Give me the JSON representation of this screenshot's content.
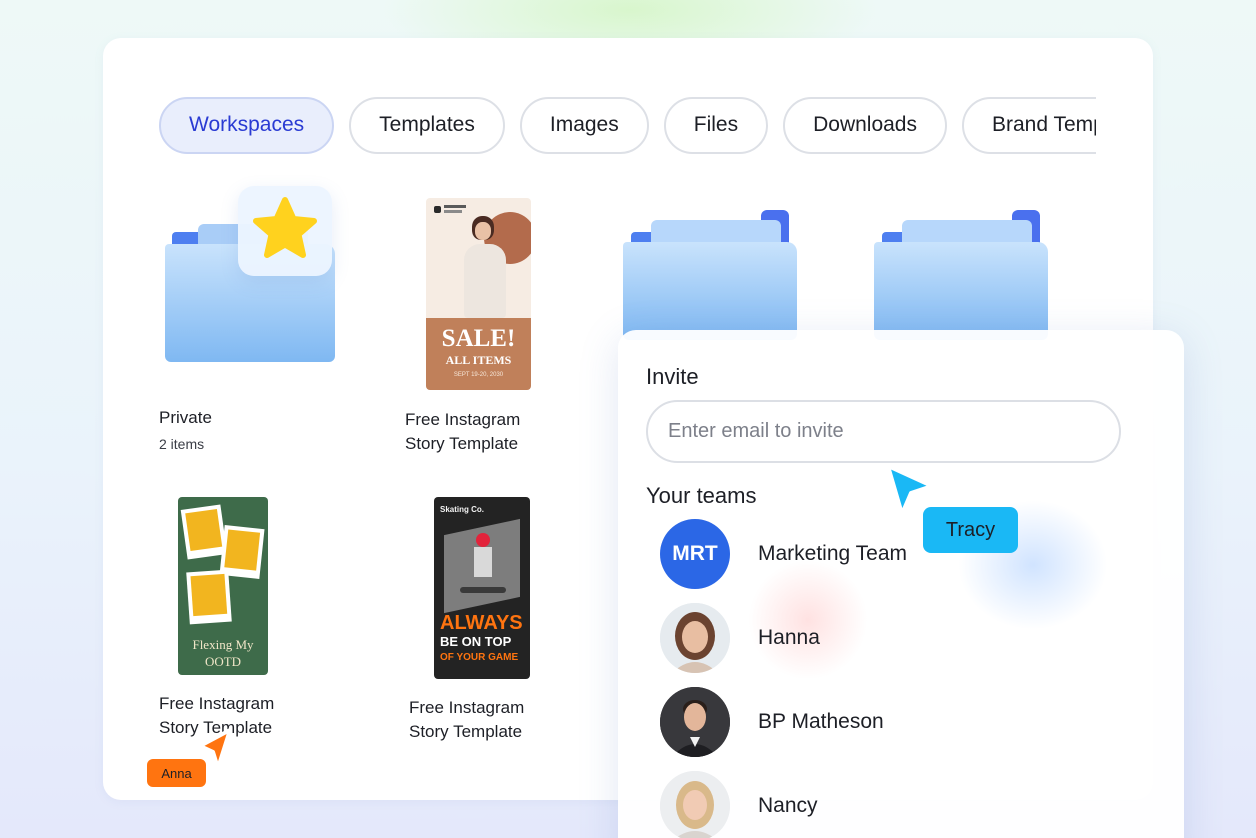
{
  "tabs": [
    {
      "label": "Workspaces",
      "active": true
    },
    {
      "label": "Templates",
      "active": false
    },
    {
      "label": "Images",
      "active": false
    },
    {
      "label": "Files",
      "active": false
    },
    {
      "label": "Downloads",
      "active": false
    },
    {
      "label": "Brand Templates",
      "active": false
    }
  ],
  "tiles": {
    "private": {
      "title": "Private",
      "subtitle": "2 items",
      "icon": "folder-star-icon"
    },
    "sale_template": {
      "title_line1": "Free Instagram",
      "title_line2": "Story Template",
      "thumb_title": "SALE!",
      "thumb_sub": "ALL ITEMS",
      "thumb_date": "SEPT 19-20, 2030"
    },
    "ootd_template": {
      "title_line1": "Free Instagram",
      "title_line2": "Story Template",
      "thumb_text_line1": "Flexing My",
      "thumb_text_line2": "OOTD"
    },
    "skate_template": {
      "title_line1": "Free Instagram",
      "title_line2": "Story Template",
      "thumb_brand": "Skating Co.",
      "thumb_line1": "ALWAYS",
      "thumb_line2": "BE ON TOP",
      "thumb_line3": "OF YOUR GAME"
    }
  },
  "invite": {
    "title": "Invite",
    "email_placeholder": "Enter email to invite",
    "teams_title": "Your teams",
    "members": [
      {
        "name": "Marketing Team",
        "initials": "MRT"
      },
      {
        "name": "Hanna"
      },
      {
        "name": "BP Matheson"
      },
      {
        "name": "Nancy"
      }
    ]
  },
  "collaborators": {
    "tracy": {
      "label": "Tracy",
      "color": "#1ab8f5"
    },
    "anna": {
      "label": "Anna",
      "color": "#ff7410"
    }
  },
  "colors": {
    "accent": "#2a3bd3",
    "team_avatar": "#2b67e6",
    "folder": "#7fb8f2"
  }
}
